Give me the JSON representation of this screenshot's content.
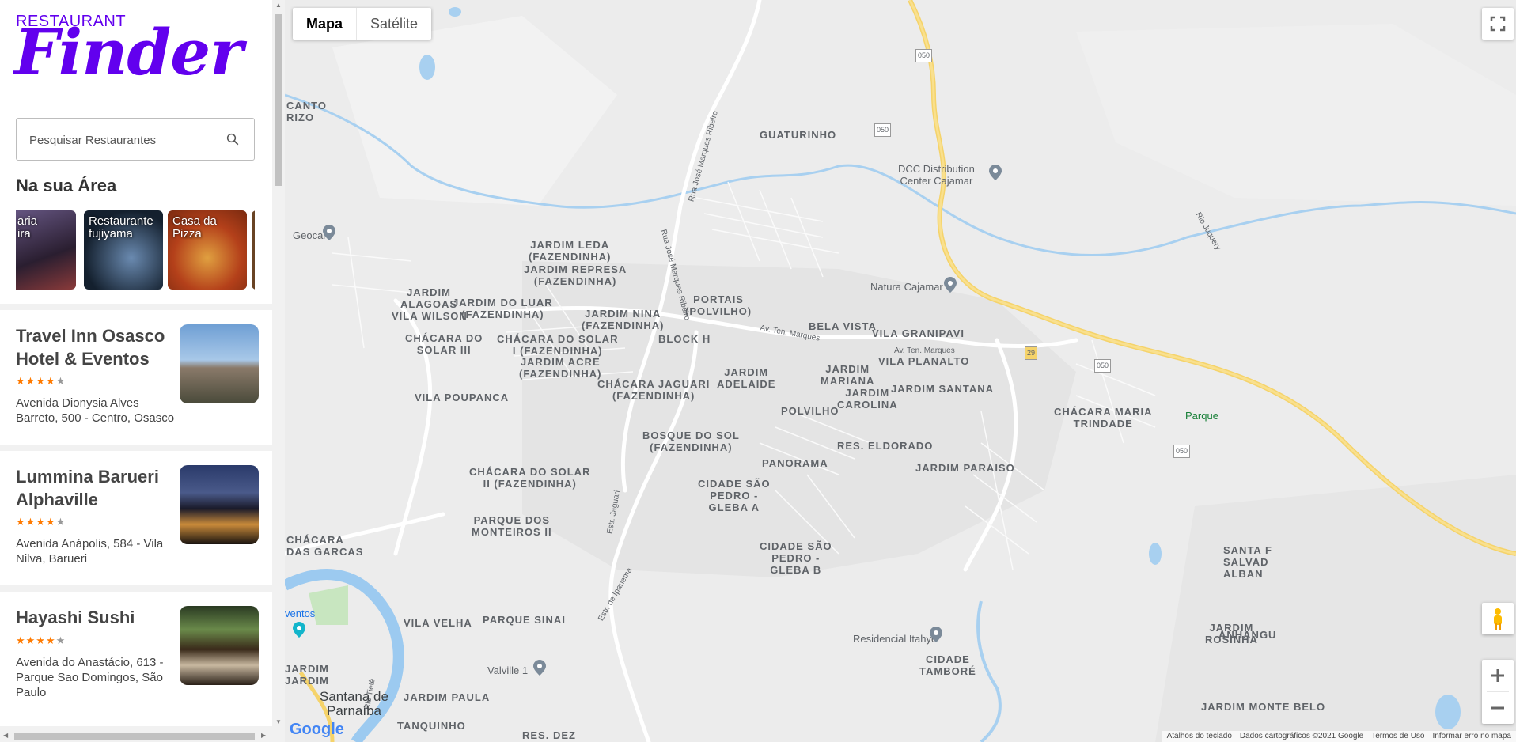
{
  "sidebar": {
    "logo_small": "RESTAURANT",
    "logo_big": "Finder",
    "search_placeholder": "Pesquisar Restaurantes",
    "area_title": "Na sua Área",
    "carousel": [
      {
        "label": "aria\nira",
        "color": "#3a2a4a"
      },
      {
        "label": "Restaurante fujiyama",
        "color": "#1c2a3a"
      },
      {
        "label": "Casa da Pizza",
        "color": "#c8541c"
      },
      {
        "label": "",
        "color": "#5a3a22"
      }
    ],
    "restaurants": [
      {
        "name": "Travel Inn Osasco Hotel & Eventos",
        "rating": 4,
        "address": "Avenida Dionysia Alves Barreto, 500 - Centro, Osasco"
      },
      {
        "name": "Lummina Barueri Alphaville",
        "rating": 4,
        "address": "Avenida Anápolis, 584 - Vila Nilva, Barueri"
      },
      {
        "name": "Hayashi Sushi",
        "rating": 4,
        "address": "Avenida do Anastácio, 613 - Parque Sao Domingos, São Paulo"
      }
    ]
  },
  "map": {
    "type_buttons": [
      "Mapa",
      "Satélite"
    ],
    "neighborhoods": [
      {
        "text": "CANTO\nRIZO"
      },
      {
        "text": "GUATURINHO"
      },
      {
        "text": "JARDIM LEDA\n(FAZENDINHA)"
      },
      {
        "text": "JARDIM REPRESA\n(FAZENDINHA)"
      },
      {
        "text": "JARDIM\nALAGOAS"
      },
      {
        "text": "JARDIM DO LUAR\n(FAZENDINHA)"
      },
      {
        "text": "VILA WILSON"
      },
      {
        "text": "JARDIM NINA\n(FAZENDINHA)"
      },
      {
        "text": "PORTAIS\n(POLVILHO)"
      },
      {
        "text": "BELA VISTA"
      },
      {
        "text": "VILA GRANIPAVI"
      },
      {
        "text": "CHÁCARA DO\nSOLAR III"
      },
      {
        "text": "CHÁCARA DO SOLAR\nI (FAZENDINHA)"
      },
      {
        "text": "BLOCK H"
      },
      {
        "text": "JARDIM\nMARIANA"
      },
      {
        "text": "VILA PLANALTO"
      },
      {
        "text": "JARDIM ACRE\n(FAZENDINHA)"
      },
      {
        "text": "JARDIM\nADELAIDE"
      },
      {
        "text": "CHÁCARA JAGUARI\n(FAZENDINHA)"
      },
      {
        "text": "JARDIM\nCAROLINA"
      },
      {
        "text": "JARDIM SANTANA"
      },
      {
        "text": "VILA POUPANCA"
      },
      {
        "text": "POLVILHO"
      },
      {
        "text": "CHÁCARA MARIA\nTRINDADE"
      },
      {
        "text": "BOSQUE DO SOL\n(FAZENDINHA)"
      },
      {
        "text": "RES. ELDORADO"
      },
      {
        "text": "PANORAMA"
      },
      {
        "text": "JARDIM PARAISO"
      },
      {
        "text": "CHÁCARA DO SOLAR\nII (FAZENDINHA)"
      },
      {
        "text": "CIDADE SÃO\nPEDRO -\nGLEBA A"
      },
      {
        "text": "PARQUE DOS\nMONTEIROS II"
      },
      {
        "text": "CHÁCARA\nDAS GARCAS"
      },
      {
        "text": "CIDADE SÃO\nPEDRO -\nGLEBA B"
      },
      {
        "text": "PARQUE SINAI"
      },
      {
        "text": "VILA VELHA"
      },
      {
        "text": "CIDADE\nTAMBORÉ"
      },
      {
        "text": "JARDIM\nROSINHA"
      },
      {
        "text": "JARDIM\nJARDIM"
      },
      {
        "text": "JARDIM PAULA"
      },
      {
        "text": "JARDIM MONTE BELO"
      },
      {
        "text": "TANQUINHO"
      },
      {
        "text": "RES. DEZ"
      }
    ],
    "pois": [
      {
        "text": "DCC Distribution\nCenter Cajamar"
      },
      {
        "text": "Geocal"
      },
      {
        "text": "Natura Cajamar"
      },
      {
        "text": "Residencial Itahyê"
      },
      {
        "text": "Valville 1"
      },
      {
        "text": "Parque"
      },
      {
        "text": "ventos"
      },
      {
        "text": "SANTA F\nSALVAD\nALBAN"
      },
      {
        "text": "ANHANGU"
      }
    ],
    "city": "Santana de\nParnaíba",
    "road_labels": [
      "050",
      "29"
    ],
    "street_labels": [
      "Rua José Marques Ribeiro",
      "Av. Ten. Marques",
      "Estr. Jaguari",
      "Estr. de Ipanema",
      "Rio Juquery",
      "Rio Tietê"
    ],
    "footer": [
      "Atalhos do teclado",
      "Dados cartográficos ©2021 Google",
      "Termos de Uso",
      "Informar erro no mapa"
    ],
    "google_logo": "Google"
  }
}
